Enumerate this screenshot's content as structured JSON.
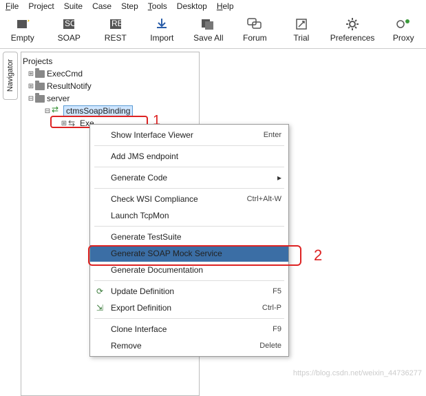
{
  "menu": {
    "file": "File",
    "project": "Project",
    "suite": "Suite",
    "case": "Case",
    "step": "Step",
    "tools": "Tools",
    "desktop": "Desktop",
    "help": "Help"
  },
  "toolbar": {
    "empty": "Empty",
    "soap": "SOAP",
    "rest": "REST",
    "import": "Import",
    "saveall": "Save All",
    "forum": "Forum",
    "trial": "Trial",
    "preferences": "Preferences",
    "proxy": "Proxy"
  },
  "sidetab": "Navigator",
  "tree": {
    "root": "Projects",
    "n1": "ExecCmd",
    "n2": "ResultNotify",
    "n3": "server",
    "binding": "ctmsSoapBinding",
    "op": "Exe"
  },
  "ctx": {
    "showViewer": "Show Interface Viewer",
    "showViewer_sc": "Enter",
    "addJms": "Add JMS endpoint",
    "genCode": "Generate Code",
    "checkWsi": "Check WSI Compliance",
    "checkWsi_sc": "Ctrl+Alt-W",
    "tcpmon": "Launch TcpMon",
    "genSuite": "Generate TestSuite",
    "genMock": "Generate SOAP Mock Service",
    "genDoc": "Generate Documentation",
    "updDef": "Update Definition",
    "updDef_sc": "F5",
    "expDef": "Export Definition",
    "expDef_sc": "Ctrl-P",
    "clone": "Clone Interface",
    "clone_sc": "F9",
    "remove": "Remove",
    "remove_sc": "Delete"
  },
  "ann": {
    "a1": "1",
    "a2": "2"
  },
  "watermark": "https://blog.csdn.net/weixin_44736277"
}
